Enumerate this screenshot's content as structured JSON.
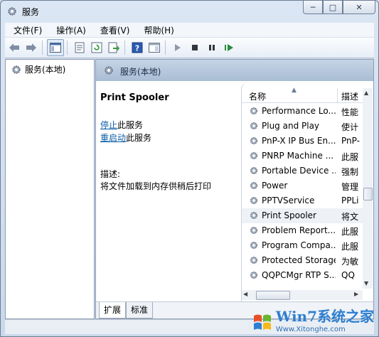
{
  "window": {
    "title": "服务",
    "icon": "gear-icon"
  },
  "caption_buttons": {
    "minimize": "─",
    "maximize": "□",
    "close": "✕"
  },
  "menu": [
    {
      "label": "文件(F)"
    },
    {
      "label": "操作(A)"
    },
    {
      "label": "查看(V)"
    },
    {
      "label": "帮助(H)"
    }
  ],
  "toolbar": {
    "icons": [
      "back-arrow-icon",
      "forward-arrow-icon",
      "console-tree-icon",
      "properties-icon",
      "refresh-icon",
      "export-list-icon",
      "help-icon",
      "view-icon",
      "play-icon",
      "stop-icon",
      "pause-icon",
      "restart-icon"
    ]
  },
  "tree": {
    "root_label": "服务(本地)"
  },
  "pane_header": {
    "title": "服务(本地)"
  },
  "detail": {
    "service_name": "Print Spooler",
    "stop_link": "停止",
    "stop_suffix": "此服务",
    "restart_link": "重启动",
    "restart_suffix": "此服务",
    "desc_label": "描述:",
    "desc_text": "将文件加载到内存供稍后打印"
  },
  "list": {
    "col_name": "名称",
    "col_desc": "描述",
    "rows": [
      {
        "name": "Performance Lo...",
        "desc": "性能"
      },
      {
        "name": "Plug and Play",
        "desc": "使计"
      },
      {
        "name": "PnP-X IP Bus En...",
        "desc": "PnP-"
      },
      {
        "name": "PNRP Machine ...",
        "desc": "此服"
      },
      {
        "name": "Portable Device ...",
        "desc": "强制"
      },
      {
        "name": "Power",
        "desc": "管理"
      },
      {
        "name": "PPTVService",
        "desc": "PPLi"
      },
      {
        "name": "Print Spooler",
        "desc": "将文",
        "selected": true
      },
      {
        "name": "Problem Report...",
        "desc": "此服"
      },
      {
        "name": "Program Compa...",
        "desc": "此服"
      },
      {
        "name": "Protected Storage",
        "desc": "为敏"
      },
      {
        "name": "QQPCMgr RTP S...",
        "desc": "QQ"
      }
    ]
  },
  "tabs": [
    {
      "label": "扩展",
      "active": true
    },
    {
      "label": "标准",
      "active": false
    }
  ],
  "watermark": {
    "line1": "Win7系统之家",
    "line2": "Www.Xitonghe.com"
  },
  "colors": {
    "link": "#0b5eaa",
    "header": "#a9bdd5",
    "selected_row": "#eef2f7"
  }
}
